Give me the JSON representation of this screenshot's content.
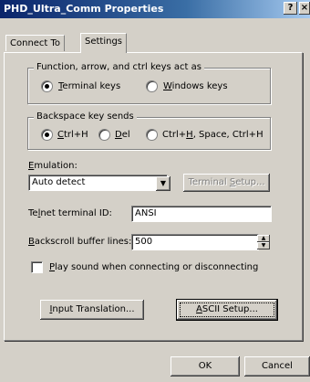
{
  "window": {
    "title": "PHD_Ultra_Comm Properties",
    "help_button": "?",
    "close_button": "×"
  },
  "tabs": [
    {
      "label": "Connect To",
      "active": false
    },
    {
      "label": "Settings",
      "active": true
    }
  ],
  "keys_group": {
    "legend": "Function, arrow, and ctrl keys act as",
    "options": [
      {
        "mn": "T",
        "rest": "erminal keys",
        "selected": true
      },
      {
        "mn": "W",
        "rest": "indows keys",
        "selected": false
      }
    ]
  },
  "backspace_group": {
    "legend": "Backspace key sends",
    "options": [
      {
        "pre": "",
        "mn": "C",
        "rest": "trl+H",
        "selected": true
      },
      {
        "pre": "",
        "mn": "D",
        "rest": "el",
        "selected": false
      },
      {
        "pre": "Ctrl+",
        "mn": "H",
        "rest": ", Space, Ctrl+H",
        "selected": false
      }
    ]
  },
  "emulation": {
    "label_mn": "E",
    "label_rest": "mulation:",
    "value": "Auto detect",
    "dropdown_glyph": "▼",
    "terminal_setup_pre": "Terminal ",
    "terminal_setup_mn": "S",
    "terminal_setup_rest": "etup..."
  },
  "terminal_id": {
    "label_pre": "Te",
    "label_mn": "l",
    "label_rest": "net terminal ID:",
    "value": "ANSI"
  },
  "backscroll": {
    "label_mn": "B",
    "label_rest": "ackscroll buffer lines:",
    "value": "500",
    "spin_up": "▲",
    "spin_down": "▼"
  },
  "sound": {
    "label_mn": "P",
    "label_rest": "lay sound when connecting or disconnecting",
    "checked": false
  },
  "buttons": {
    "input_translation_mn": "I",
    "input_translation_rest": "nput Translation...",
    "ascii_setup_mn": "A",
    "ascii_setup_rest": "SCII Setup...",
    "ok": "OK",
    "cancel": "Cancel"
  }
}
